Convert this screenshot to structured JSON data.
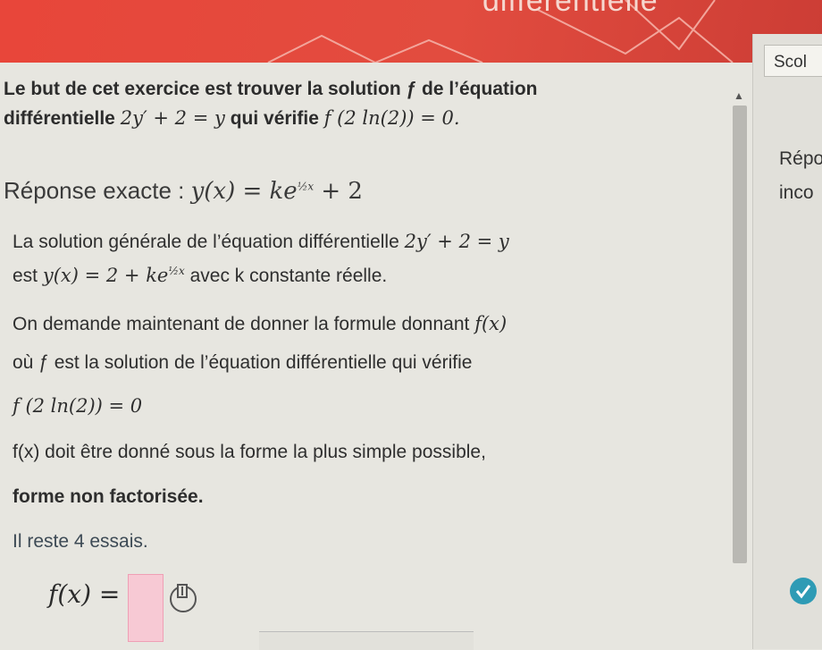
{
  "banner": {
    "title": "différentielle"
  },
  "right_panel": {
    "tab_label": "Scol",
    "reponse_label": "Répo",
    "status_label": "inco"
  },
  "question": {
    "line1": "Le but de cet exercice est trouver la solution ƒ de l’équation",
    "line2_prefix": "différentielle",
    "line2_eq": "2y′ + 2 = y",
    "line2_mid": "qui vérifie",
    "line2_cond": "f (2 ln(2)) = 0."
  },
  "answer": {
    "label": "Réponse exacte :",
    "formula_left": "y(x) = ke",
    "formula_exp": "½x",
    "formula_right": "+ 2"
  },
  "explanation": {
    "l1": "La solution générale de l’équation différentielle",
    "l1_eq": "2y′ + 2 = y",
    "l2_prefix": "est",
    "l2_formula": "y(x) = 2 + ke",
    "l2_exp": "½x",
    "l2_suffix": "avec k constante réelle.",
    "l3": "On demande maintenant de donner la formule donnant",
    "l3_eq": "f(x)",
    "l4": "où ƒ est la solution de l’équation différentielle qui vérifie",
    "l5": "f (2 ln(2)) = 0",
    "l6": "f(x) doit être donné sous la forme la plus simple possible,",
    "l7": "forme non factorisée."
  },
  "attempts": {
    "text": "Il reste 4 essais."
  },
  "input": {
    "label": "f(x) ="
  },
  "icons": {
    "keyboard": "math-keyboard-icon",
    "check": "check-icon",
    "scroll_up": "chevron-up-icon"
  },
  "colors": {
    "banner": "#e8463a",
    "input_bg": "#f7c9d4",
    "check": "#2e9bb5"
  }
}
